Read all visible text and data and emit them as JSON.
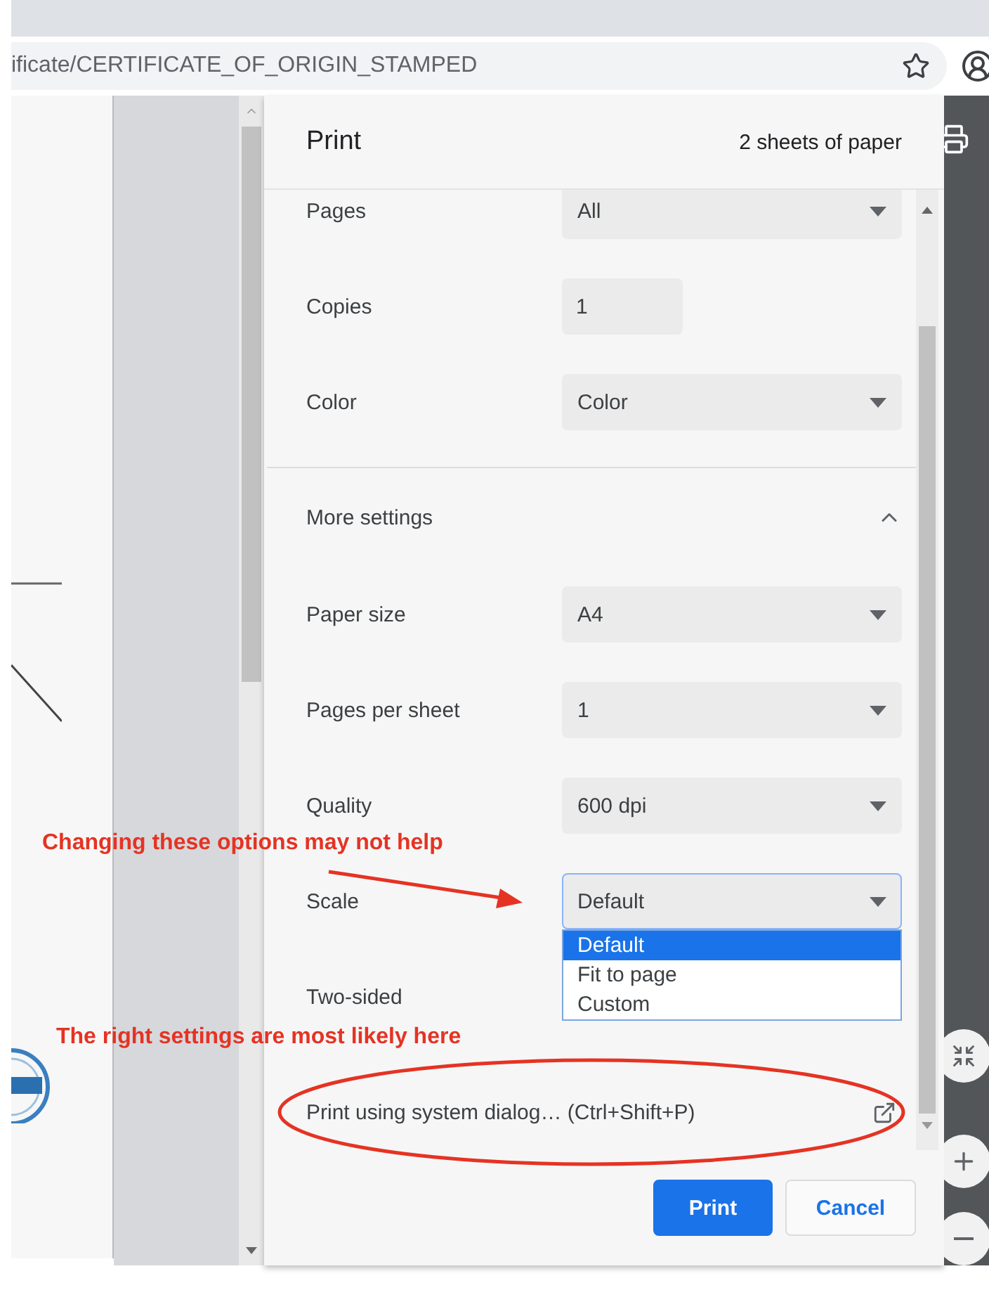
{
  "browser": {
    "url": "ificate/CERTIFICATE_OF_ORIGIN_STAMPED"
  },
  "dialog": {
    "title": "Print",
    "sheets": "2 sheets of paper",
    "settings": [
      {
        "kind": "select",
        "label": "Pages",
        "value": "All"
      },
      {
        "kind": "input",
        "label": "Copies",
        "value": "1"
      },
      {
        "kind": "select",
        "label": "Color",
        "value": "Color"
      }
    ],
    "more_settings": {
      "label": "More settings",
      "expanded": true
    },
    "more": [
      {
        "kind": "select",
        "label": "Paper size",
        "value": "A4",
        "open": false
      },
      {
        "kind": "select",
        "label": "Pages per sheet",
        "value": "1",
        "open": false
      },
      {
        "kind": "select",
        "label": "Quality",
        "value": "600 dpi",
        "open": false
      },
      {
        "kind": "select",
        "label": "Scale",
        "value": "Default",
        "open": true,
        "options": [
          {
            "label": "Default",
            "selected": true
          },
          {
            "label": "Fit to page",
            "selected": false
          },
          {
            "label": "Custom",
            "selected": false
          }
        ]
      },
      {
        "kind": "label",
        "label": "Two-sided"
      }
    ],
    "system_dialog": "Print using system dialog… (Ctrl+Shift+P)",
    "buttons": [
      {
        "label": "Print",
        "kind": "primary"
      },
      {
        "label": "Cancel",
        "kind": "secondary"
      }
    ]
  },
  "annotations": [
    {
      "kind": "arrow",
      "text": "Changing these options may not help"
    },
    {
      "kind": "ellipse",
      "text": "The right settings are most likely here"
    }
  ]
}
